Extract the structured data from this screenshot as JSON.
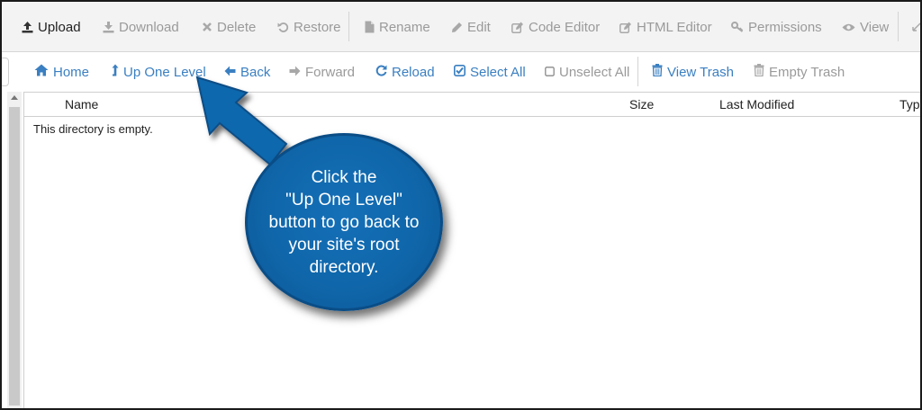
{
  "colors": {
    "link_blue": "#3a7fc1",
    "muted": "#9a9a9a",
    "callout_blue": "#0f65a8"
  },
  "toolbar": {
    "items": [
      {
        "label": "Upload",
        "icon": "upload-icon",
        "state": "enabled"
      },
      {
        "label": "Download",
        "icon": "download-icon",
        "state": "disabled"
      },
      {
        "label": "Delete",
        "icon": "close-icon",
        "state": "disabled"
      },
      {
        "label": "Restore",
        "icon": "undo-icon",
        "state": "disabled"
      },
      {
        "label": "Rename",
        "icon": "file-icon",
        "state": "disabled"
      },
      {
        "label": "Edit",
        "icon": "pencil-icon",
        "state": "disabled"
      },
      {
        "label": "Code Editor",
        "icon": "edit-square-icon",
        "state": "disabled"
      },
      {
        "label": "HTML Editor",
        "icon": "edit-square-icon",
        "state": "disabled"
      },
      {
        "label": "Permissions",
        "icon": "key-icon",
        "state": "disabled"
      },
      {
        "label": "View",
        "icon": "eye-icon",
        "state": "disabled"
      }
    ]
  },
  "navbar": {
    "items": [
      {
        "label": "Home",
        "icon": "home-icon",
        "state": "enabled"
      },
      {
        "label": "Up One Level",
        "icon": "level-up-icon",
        "state": "enabled"
      },
      {
        "label": "Back",
        "icon": "arrow-left-icon",
        "state": "enabled"
      },
      {
        "label": "Forward",
        "icon": "arrow-right-icon",
        "state": "disabled"
      },
      {
        "label": "Reload",
        "icon": "refresh-icon",
        "state": "enabled"
      },
      {
        "label": "Select All",
        "icon": "checkbox-checked-icon",
        "state": "enabled"
      },
      {
        "label": "Unselect All",
        "icon": "checkbox-empty-icon",
        "state": "disabled"
      },
      {
        "label": "View Trash",
        "icon": "trash-icon",
        "state": "enabled"
      },
      {
        "label": "Empty Trash",
        "icon": "trash-icon",
        "state": "disabled"
      }
    ]
  },
  "table": {
    "columns": [
      "Name",
      "Size",
      "Last Modified",
      "Type"
    ],
    "empty_message": "This directory is empty."
  },
  "callout": {
    "text": "Click the\n\"Up One Level\"\nbutton to go back to\nyour site's root\ndirectory."
  }
}
